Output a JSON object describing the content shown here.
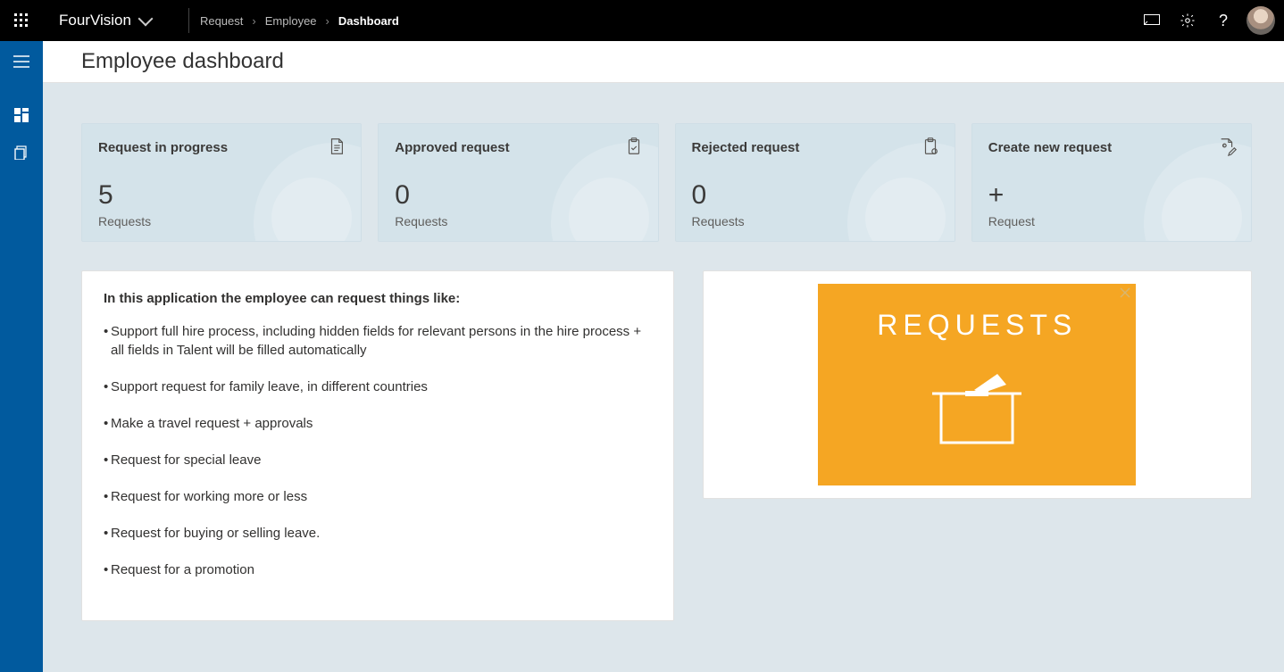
{
  "header": {
    "brand": "FourVision",
    "breadcrumb": [
      "Request",
      "Employee",
      "Dashboard"
    ]
  },
  "page": {
    "title": "Employee dashboard"
  },
  "cards": [
    {
      "title": "Request in progress",
      "value": "5",
      "sub": "Requests"
    },
    {
      "title": "Approved request",
      "value": "0",
      "sub": "Requests"
    },
    {
      "title": "Rejected request",
      "value": "0",
      "sub": "Requests"
    },
    {
      "title": "Create new request",
      "value": "+",
      "sub": "Request"
    }
  ],
  "info": {
    "intro": "In this application the employee can request things like:",
    "items": [
      "Support full hire process, including hidden fields for relevant persons in the hire process + all fields in Talent will be filled automatically",
      "Support request for family leave, in different countries",
      "Make a travel request + approvals",
      "Request for special leave",
      "Request for working more or less",
      "Request for buying or selling leave.",
      "Request for a promotion"
    ]
  },
  "promo": {
    "label": "REQUESTS"
  }
}
